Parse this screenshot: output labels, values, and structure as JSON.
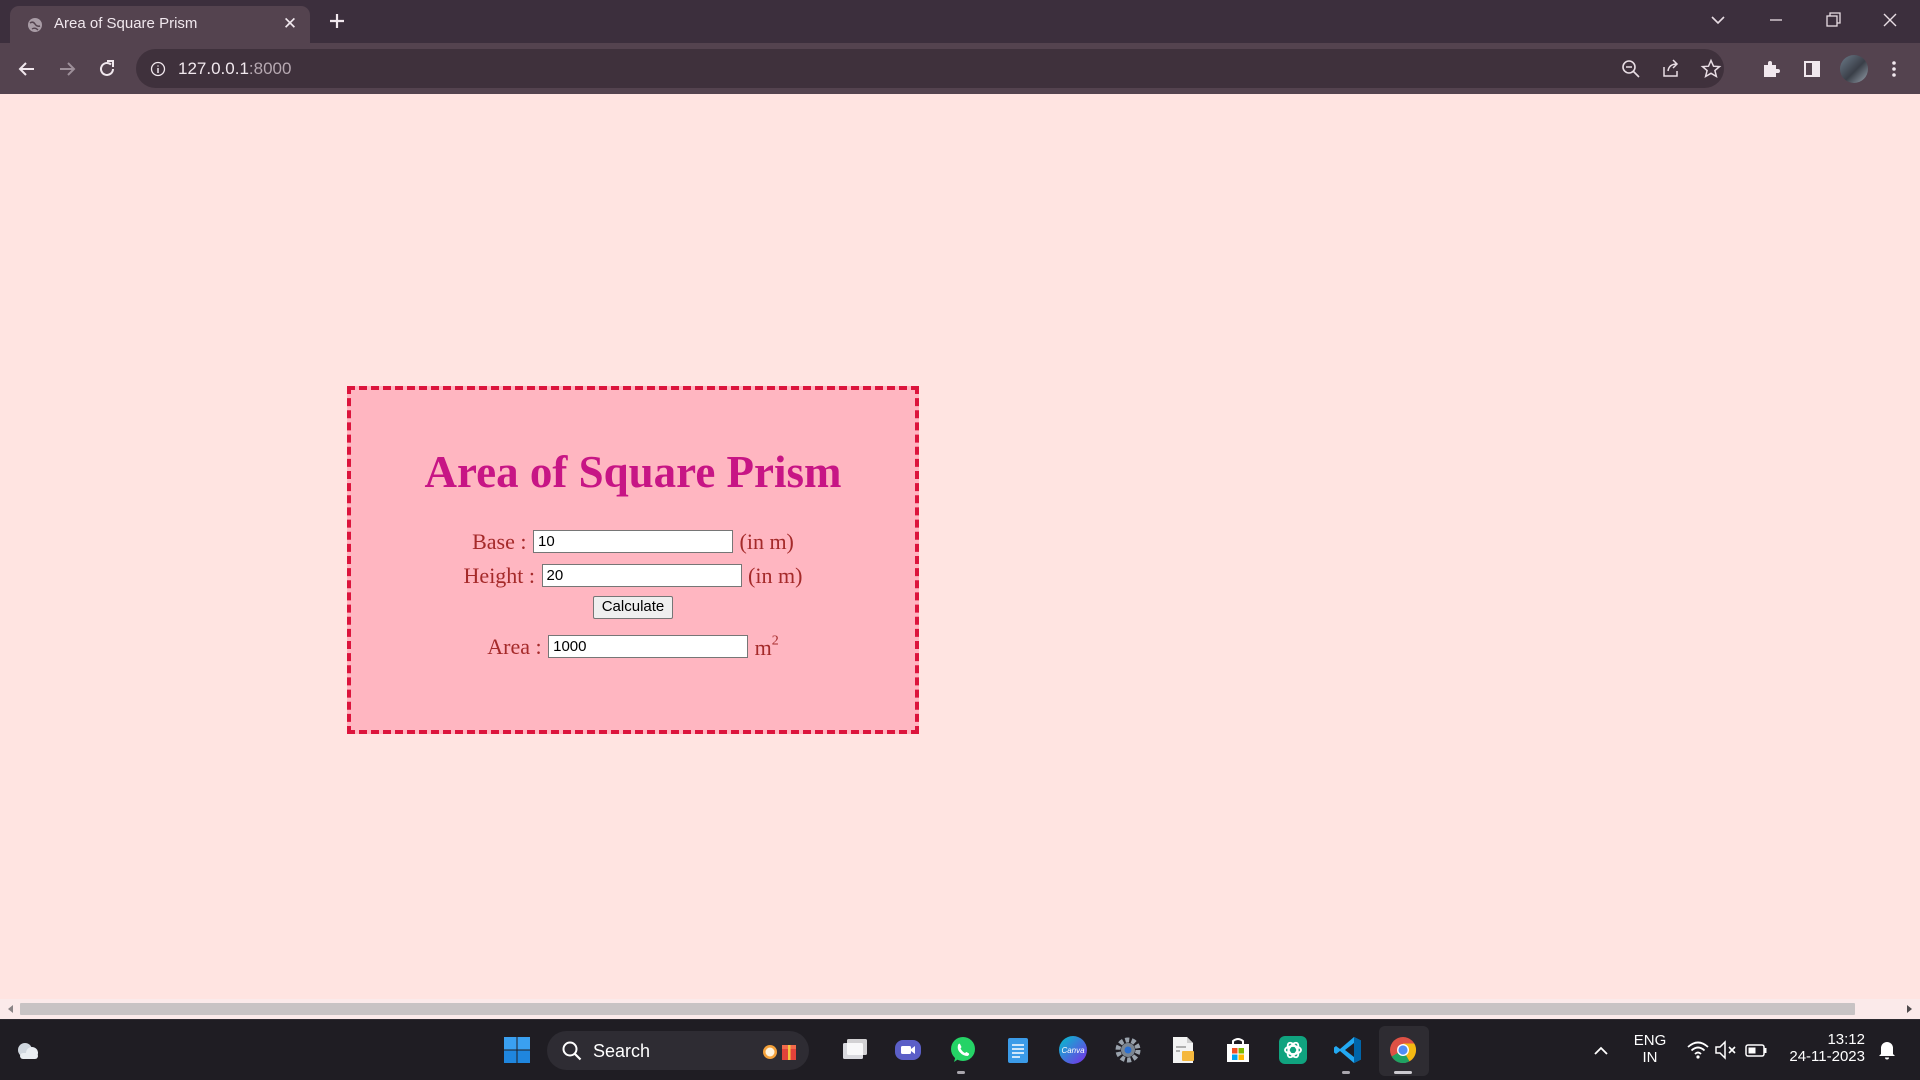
{
  "browser": {
    "tab_title": "Area of Square Prism",
    "url_host": "127.0.0.1",
    "url_port": ":8000"
  },
  "page": {
    "title": "Area of Square Prism",
    "base": {
      "label": "Base :",
      "value": "10",
      "unit": "(in m)"
    },
    "height": {
      "label": "Height :",
      "value": "20",
      "unit": "(in m)"
    },
    "calculate_label": "Calculate",
    "area": {
      "label": "Area :",
      "value": "1000",
      "unit": "m",
      "unit_sup": "2"
    },
    "colors": {
      "page_bg": "#ffe4e1",
      "card_bg": "#ffb6c1",
      "card_border": "#dc143c",
      "title": "#c71585",
      "label": "#a52a2a"
    }
  },
  "taskbar": {
    "search_label": "Search",
    "language_line1": "ENG",
    "language_line2": "IN",
    "time": "13:12",
    "date": "24-11-2023",
    "pinned_apps": [
      "start-icon",
      "search-icon",
      "widgets-icon",
      "task-view-icon",
      "teams-icon",
      "whatsapp-icon",
      "notepad-icon",
      "canva-icon",
      "settings-icon",
      "file-icon",
      "store-icon",
      "chatgpt-icon",
      "vscode-icon",
      "chrome-icon"
    ]
  }
}
